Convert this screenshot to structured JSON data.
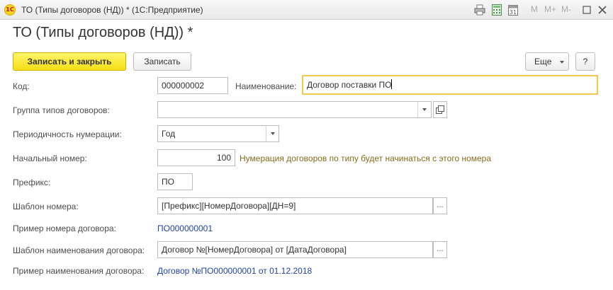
{
  "window": {
    "logo_text": "1С",
    "title": "ТО (Типы договоров (НД)) *  (1С:Предприятие)",
    "memory_buttons": [
      "M",
      "M+",
      "M-"
    ]
  },
  "form": {
    "title": "ТО (Типы договоров (НД)) *"
  },
  "toolbar": {
    "save_close_label": "Записать и закрыть",
    "save_label": "Записать",
    "more_label": "Еще",
    "help_label": "?"
  },
  "fields": {
    "code": {
      "label": "Код:",
      "value": "000000002"
    },
    "name": {
      "label": "Наименование:",
      "value": "Договор поставки ПО"
    },
    "group": {
      "label": "Группа типов договоров:",
      "value": ""
    },
    "periodicity": {
      "label": "Периодичность нумерации:",
      "value": "Год"
    },
    "start_number": {
      "label": "Начальный номер:",
      "value": "100",
      "hint": "Нумерация договоров по типу будет начинаться с этого номера"
    },
    "prefix": {
      "label": "Префикс:",
      "value": "ПО"
    },
    "number_template": {
      "label": "Шаблон номера:",
      "value": "[Префикс][НомерДоговора][ДН=9]"
    },
    "number_example": {
      "label": "Пример номера договора:",
      "value": "ПО000000001"
    },
    "name_template": {
      "label": "Шаблон наименования договора:",
      "value": "Договор №[НомерДоговора] от [ДатаДоговора]"
    },
    "name_example": {
      "label": "Пример наименования договора:",
      "value": "Договор №ПО000000001 от 01.12.2018"
    }
  },
  "icons": {
    "title_bar": [
      "print-icon",
      "calculator-icon",
      "calendar-icon",
      "minimize-icon",
      "maximize-icon",
      "close-icon"
    ],
    "field": [
      "dropdown-icon",
      "open-icon",
      "ellipsis-icon"
    ]
  },
  "colors": {
    "primary_button": "#f5de14",
    "focus_border": "#f2cb4a",
    "link": "#2142a8",
    "hint": "#8a6a1c"
  }
}
